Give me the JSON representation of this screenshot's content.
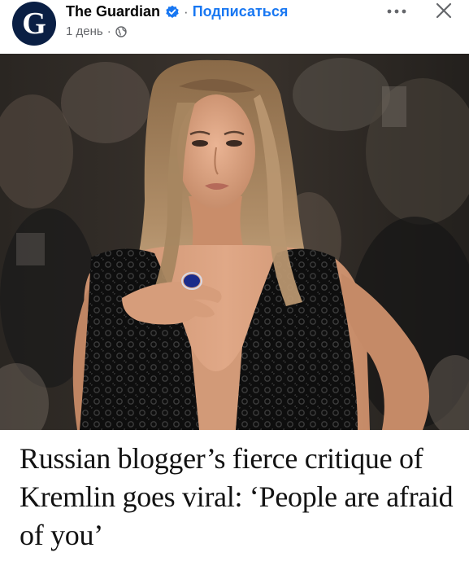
{
  "post": {
    "page_name": "The Guardian",
    "subscribe_label": "Подписаться",
    "time": "1 день",
    "separator": "·",
    "avatar_letter": "G",
    "icons": {
      "avatar": "guardian-logo",
      "verified": "verified-badge-icon",
      "privacy": "globe-icon",
      "more": "more-horizontal-icon",
      "close": "close-icon"
    }
  },
  "article": {
    "headline": "Russian blogger’s fierce critique of Kremlin goes viral: ‘People are afraid of you’"
  },
  "colors": {
    "brand_navy": "#0a1f44",
    "link_blue": "#1877f2",
    "meta_gray": "#65676b",
    "headline_text": "#121212"
  }
}
